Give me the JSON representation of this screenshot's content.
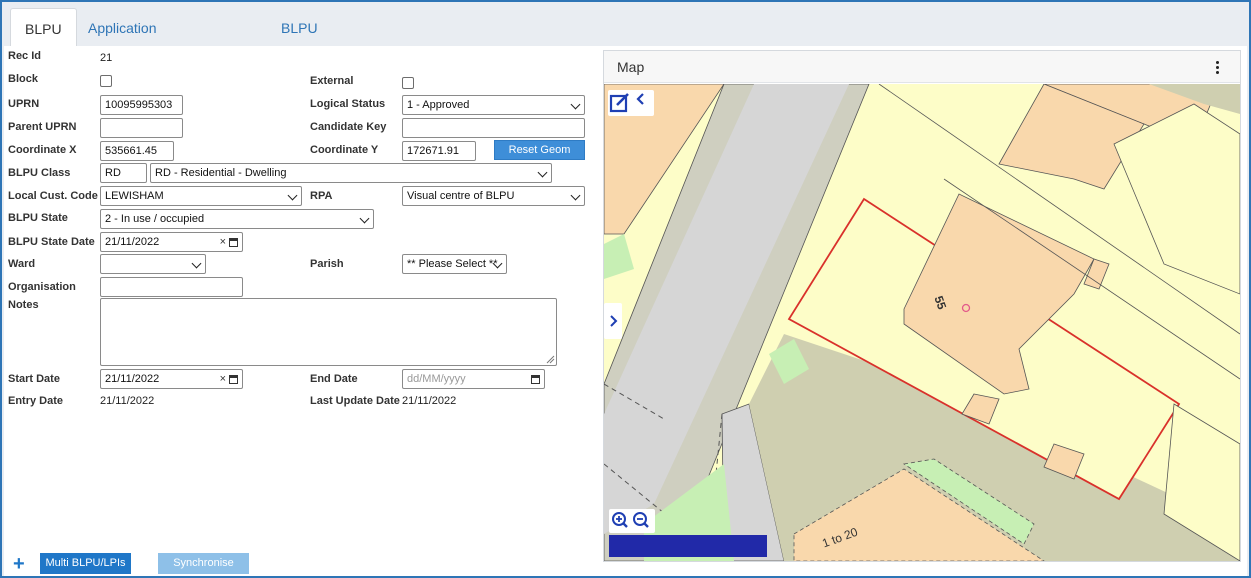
{
  "tabs": [
    {
      "label": "BLPU",
      "active": true
    },
    {
      "label": "Application Cross Reference",
      "active": false
    },
    {
      "label": "BLPU Classes",
      "active": false
    }
  ],
  "form": {
    "rec_id_label": "Rec Id",
    "rec_id_value": "21",
    "block_label": "Block",
    "block_checked": false,
    "external_label": "External",
    "external_checked": false,
    "uprn_label": "UPRN",
    "uprn_value": "10095995303",
    "logical_status_label": "Logical Status",
    "logical_status_value": "1 - Approved",
    "parent_uprn_label": "Parent UPRN",
    "parent_uprn_value": "",
    "candidate_key_label": "Candidate Key",
    "candidate_key_value": "",
    "coord_x_label": "Coordinate X",
    "coord_x_value": "535661.45",
    "coord_y_label": "Coordinate Y",
    "coord_y_value": "172671.91",
    "reset_geom_label": "Reset Geom",
    "blpu_class_label": "BLPU Class",
    "blpu_class_code": "RD",
    "blpu_class_value": "RD - Residential - Dwelling",
    "local_cust_code_label": "Local Cust. Code",
    "local_cust_code_value": "LEWISHAM",
    "rpa_label": "RPA",
    "rpa_value": "Visual centre of BLPU",
    "blpu_state_label": "BLPU State",
    "blpu_state_value": "2 - In use / occupied",
    "blpu_state_date_label": "BLPU State Date",
    "blpu_state_date_value": "21/11/2022",
    "ward_label": "Ward",
    "ward_value": "",
    "parish_label": "Parish",
    "parish_value": "** Please Select **",
    "organisation_label": "Organisation",
    "organisation_value": "",
    "notes_label": "Notes",
    "notes_value": "",
    "start_date_label": "Start Date",
    "start_date_value": "21/11/2022",
    "end_date_label": "End Date",
    "end_date_placeholder": "dd/MM/yyyy",
    "entry_date_label": "Entry Date",
    "entry_date_value": "21/11/2022",
    "last_update_label": "Last Update Date",
    "last_update_value": "21/11/2022",
    "clear_symbol": "×"
  },
  "footer": {
    "plus_symbol": "+",
    "multi_label": "Multi BLPU/LPIs",
    "sync_label": "Synchronise"
  },
  "map": {
    "title": "Map",
    "house_number": "55",
    "block_label": "1 to 20"
  },
  "colors": {
    "accent": "#2e75b6",
    "button": "#3e8ed8",
    "scalebar": "#2129a8",
    "boundary": "#d9312b"
  }
}
